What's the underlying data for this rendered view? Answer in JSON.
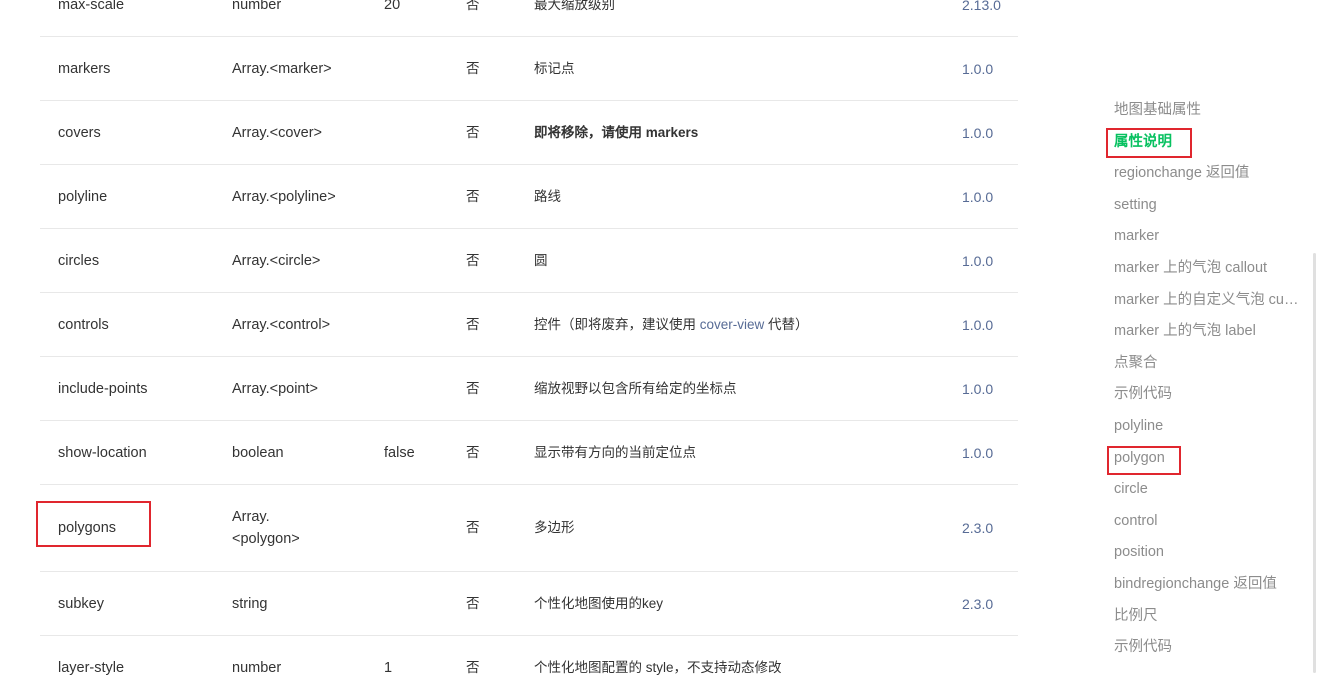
{
  "table": {
    "rows": [
      {
        "name": "max-scale",
        "type": "number",
        "default": "20",
        "required": "否",
        "desc": "最大缩放级别",
        "version": "2.13.0"
      },
      {
        "name": "markers",
        "type": "Array.<marker>",
        "default": "",
        "required": "否",
        "desc": "标记点",
        "version": "1.0.0"
      },
      {
        "name": "covers",
        "type": "Array.<cover>",
        "default": "",
        "required": "否",
        "desc": "即将移除，请使用 markers",
        "version": "1.0.0"
      },
      {
        "name": "polyline",
        "type": "Array.<polyline>",
        "default": "",
        "required": "否",
        "desc": "路线",
        "version": "1.0.0"
      },
      {
        "name": "circles",
        "type": "Array.<circle>",
        "default": "",
        "required": "否",
        "desc": "圆",
        "version": "1.0.0"
      },
      {
        "name": "controls",
        "type": "Array.<control>",
        "default": "",
        "required": "否",
        "desc_prefix": "控件（即将废弃，建议使用 ",
        "desc_link": "cover-view",
        "desc_suffix": " 代替）",
        "version": "1.0.0"
      },
      {
        "name": "include-points",
        "type": "Array.<point>",
        "default": "",
        "required": "否",
        "desc": "缩放视野以包含所有给定的坐标点",
        "version": "1.0.0"
      },
      {
        "name": "show-location",
        "type": "boolean",
        "default": "false",
        "required": "否",
        "desc": "显示带有方向的当前定位点",
        "version": "1.0.0"
      },
      {
        "name": "polygons",
        "type": "Array.<polygon>",
        "default": "",
        "required": "否",
        "desc": "多边形",
        "version": "2.3.0"
      },
      {
        "name": "subkey",
        "type": "string",
        "default": "",
        "required": "否",
        "desc": "个性化地图使用的key",
        "version": "2.3.0"
      },
      {
        "name": "layer-style",
        "type": "number",
        "default": "1",
        "required": "否",
        "desc": "个性化地图配置的 style，不支持动态修改",
        "version": ""
      }
    ]
  },
  "toc": {
    "items": [
      "地图基础属性",
      "属性说明",
      "regionchange 返回值",
      "setting",
      "marker",
      "marker 上的气泡 callout",
      "marker 上的自定义气泡 customCallout",
      "marker 上的气泡 label",
      "点聚合",
      "示例代码",
      "polyline",
      "polygon",
      "circle",
      "control",
      "position",
      "bindregionchange 返回值",
      "比例尺",
      "示例代码"
    ],
    "active_index": 1
  },
  "colors": {
    "accent": "#07c160",
    "link": "#576b95",
    "highlight": "#e0262e"
  }
}
